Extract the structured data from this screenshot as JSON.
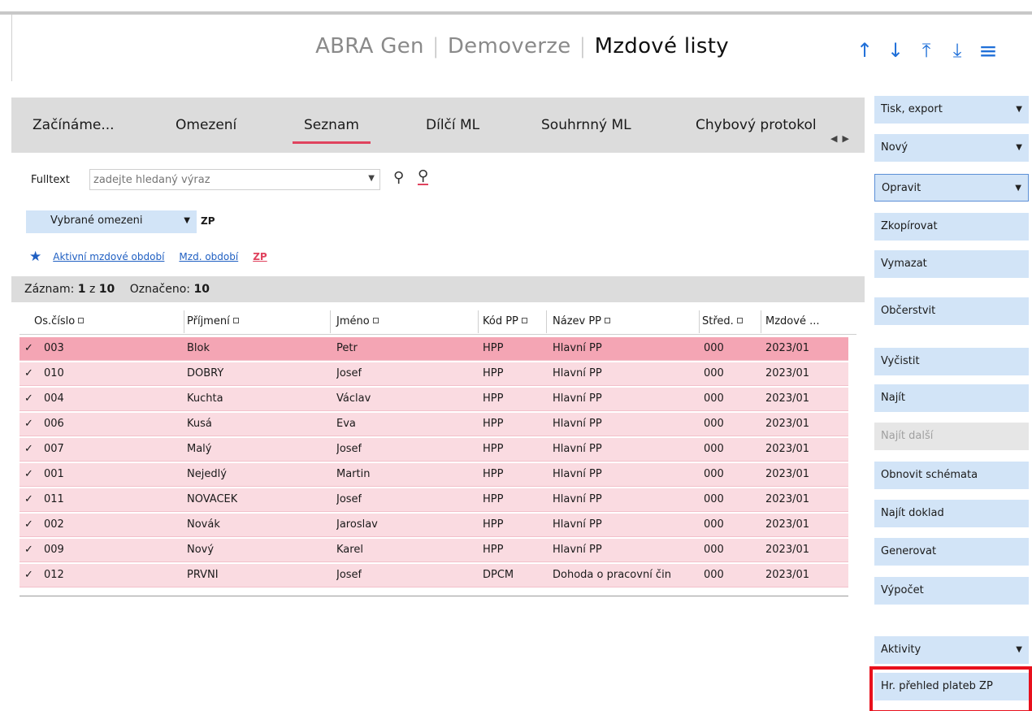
{
  "header": {
    "app": "ABRA Gen",
    "company": "Demoverze",
    "module": "Mzdové listy",
    "nav_icons": [
      "arrow-up-icon",
      "arrow-down-icon",
      "arrow-to-top-icon",
      "arrow-to-bottom-icon",
      "hamburger-menu-icon"
    ]
  },
  "tabs": [
    {
      "label": "Začínáme..."
    },
    {
      "label": "Omezení"
    },
    {
      "label": "Seznam",
      "active": true
    },
    {
      "label": "Dílčí ML"
    },
    {
      "label": "Souhrnný ML"
    },
    {
      "label": "Chybový protokol"
    }
  ],
  "filter": {
    "fulltext_label": "Fulltext",
    "search_placeholder": "zadejte hledaný výraz",
    "omezeni_label": "Vybrané omezeni",
    "omezeni_zp": "ZP",
    "links": [
      "Aktivní mzdové období",
      "Mzd. období",
      "ZP"
    ]
  },
  "status": {
    "record_label": "Záznam:",
    "record_current": "1",
    "record_of": "z",
    "record_total": "10",
    "marked_label": "Označeno:",
    "marked_count": "10"
  },
  "grid": {
    "columns": [
      "Os.číslo",
      "Příjmení",
      "Jméno",
      "Kód PP",
      "Název PP",
      "Střed.",
      "Mzdové ..."
    ],
    "rows": [
      {
        "check": "✓",
        "os": "003",
        "prijmeni": "Blok",
        "jmeno": "Petr",
        "kod": "HPP",
        "nazev": "Hlavní PP",
        "stred": "000",
        "obdobi": "2023/01",
        "selected": true
      },
      {
        "check": "✓",
        "os": "010",
        "prijmeni": "DOBRÝ",
        "jmeno": "Josef",
        "kod": "HPP",
        "nazev": "Hlavní PP",
        "stred": "000",
        "obdobi": "2023/01"
      },
      {
        "check": "✓",
        "os": "004",
        "prijmeni": "Kuchta",
        "jmeno": "Václav",
        "kod": "HPP",
        "nazev": "Hlavní PP",
        "stred": "000",
        "obdobi": "2023/01"
      },
      {
        "check": "✓",
        "os": "006",
        "prijmeni": "Kusá",
        "jmeno": "Eva",
        "kod": "HPP",
        "nazev": "Hlavní PP",
        "stred": "000",
        "obdobi": "2023/01"
      },
      {
        "check": "✓",
        "os": "007",
        "prijmeni": "Malý",
        "jmeno": "Josef",
        "kod": "HPP",
        "nazev": "Hlavní PP",
        "stred": "000",
        "obdobi": "2023/01"
      },
      {
        "check": "✓",
        "os": "001",
        "prijmeni": "Nejedlý",
        "jmeno": "Martin",
        "kod": "HPP",
        "nazev": "Hlavní PP",
        "stred": "000",
        "obdobi": "2023/01"
      },
      {
        "check": "✓",
        "os": "011",
        "prijmeni": "NOVÁČEK",
        "jmeno": "Josef",
        "kod": "HPP",
        "nazev": "Hlavní PP",
        "stred": "000",
        "obdobi": "2023/01"
      },
      {
        "check": "✓",
        "os": "002",
        "prijmeni": "Novák",
        "jmeno": "Jaroslav",
        "kod": "HPP",
        "nazev": "Hlavní PP",
        "stred": "000",
        "obdobi": "2023/01"
      },
      {
        "check": "✓",
        "os": "009",
        "prijmeni": "Nový",
        "jmeno": "Karel",
        "kod": "HPP",
        "nazev": "Hlavní PP",
        "stred": "000",
        "obdobi": "2023/01"
      },
      {
        "check": "✓",
        "os": "012",
        "prijmeni": "PRVNÍ",
        "jmeno": "Josef",
        "kod": "DPČM",
        "nazev": "Dohoda o pracovní čin",
        "stred": "000",
        "obdobi": "2023/01"
      }
    ]
  },
  "actions": [
    {
      "label": "Tisk, export",
      "dropdown": true
    },
    {
      "label": "Nový",
      "dropdown": true
    },
    {
      "label": "Opravit",
      "dropdown": true,
      "outlined": true
    },
    {
      "label": "Zkopírovat"
    },
    {
      "label": "Vymazat"
    },
    {
      "label": "Občerstvit"
    },
    {
      "label": "Vyčistit"
    },
    {
      "label": "Najít"
    },
    {
      "label": "Najít další",
      "disabled": true
    },
    {
      "label": "Obnovit schémata"
    },
    {
      "label": "Najít doklad"
    },
    {
      "label": "Generovat"
    },
    {
      "label": "Výpočet"
    },
    {
      "label": "Aktivity",
      "dropdown": true
    },
    {
      "label": "Hr. přehled plateb ZP",
      "highlighted": true
    }
  ],
  "colors": {
    "accent_blue": "#1f6fd8",
    "row_pink": "#fadbe1",
    "row_selected": "#f4a5b4",
    "button_blue": "#d2e4f7",
    "highlight_red": "#e8101c",
    "tab_underline": "#e0435e"
  }
}
